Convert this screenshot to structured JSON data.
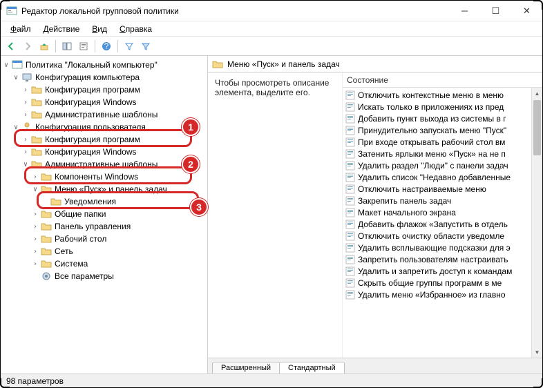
{
  "window": {
    "title": "Редактор локальной групповой политики"
  },
  "menubar": {
    "file": "Файл",
    "action": "Действие",
    "view": "Вид",
    "help": "Справка"
  },
  "tree": {
    "root": "Политика \"Локальный компьютер\"",
    "computer_cfg": "Конфигурация компьютера",
    "comp_soft": "Конфигурация программ",
    "comp_win": "Конфигурация Windows",
    "comp_admin": "Административные шаблоны",
    "user_cfg": "Конфигурация пользователя",
    "user_soft": "Конфигурация программ",
    "user_win": "Конфигурация Windows",
    "user_admin": "Административные шаблоны",
    "comp_win2": "Компоненты Windows",
    "start_menu": "Меню «Пуск» и панель задач",
    "notifications": "Уведомления",
    "shared_folders": "Общие папки",
    "control_panel": "Панель управления",
    "desktop": "Рабочий стол",
    "network": "Сеть",
    "system": "Система",
    "all_params": "Все параметры"
  },
  "right": {
    "header": "Меню «Пуск» и панель задач",
    "desc": "Чтобы просмотреть описание элемента, выделите его.",
    "col_state": "Состояние",
    "tabs": {
      "extended": "Расширенный",
      "standard": "Стандартный"
    },
    "items": [
      "Отключить контекстные меню в меню",
      "Искать только в приложениях из пред",
      "Добавить пункт выхода из системы в г",
      "Принудительно запускать меню \"Пуск\"",
      "При входе открывать рабочий стол вм",
      "Затенить ярлыки меню «Пуск» на не п",
      "Удалить раздел \"Люди\" с панели задач",
      "Удалить список \"Недавно добавленные",
      "Отключить настраиваемые меню",
      "Закрепить панель задач",
      "Макет начального экрана",
      "Добавить флажок «Запустить в отдель",
      "Отключить очистку области уведомле",
      "Удалить всплывающие подсказки для э",
      "Запретить пользователям настраивать",
      "Удалить и запретить доступ к командам",
      "Скрыть общие группы программ в ме",
      "Удалить меню «Избранное» из главно"
    ]
  },
  "status": "98 параметров",
  "badges": {
    "b1": "1",
    "b2": "2",
    "b3": "3"
  }
}
